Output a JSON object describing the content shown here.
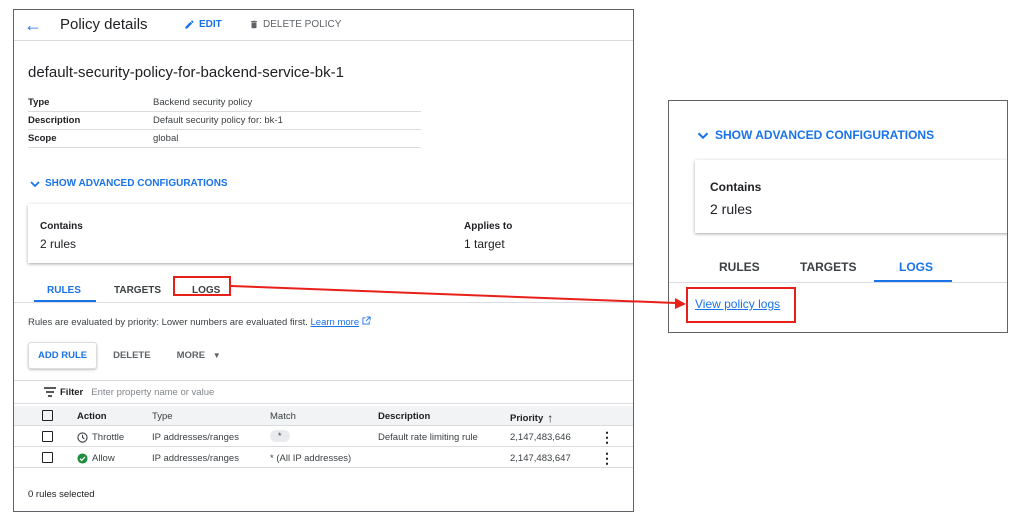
{
  "header": {
    "title": "Policy details",
    "edit_label": "EDIT",
    "delete_label": "DELETE POLICY"
  },
  "policy": {
    "name": "default-security-policy-for-backend-service-bk-1",
    "fields": [
      {
        "key": "Type",
        "value": "Backend security policy"
      },
      {
        "key": "Description",
        "value": "Default security policy for: bk-1"
      },
      {
        "key": "Scope",
        "value": "global"
      }
    ]
  },
  "advanced_label": "SHOW ADVANCED CONFIGURATIONS",
  "summary": {
    "contains_label": "Contains",
    "contains_value": "2 rules",
    "applies_label": "Applies to",
    "applies_value": "1 target"
  },
  "tabs": [
    "RULES",
    "TARGETS",
    "LOGS"
  ],
  "active_tab": "RULES",
  "eval_note": "Rules are evaluated by priority: Lower numbers are evaluated first.",
  "learn_more": "Learn more",
  "actions": {
    "add_rule": "ADD RULE",
    "delete": "DELETE",
    "more": "MORE"
  },
  "filter": {
    "label": "Filter",
    "placeholder": "Enter property name or value"
  },
  "table": {
    "headers": [
      "Action",
      "Type",
      "Match",
      "Description",
      "Priority"
    ],
    "rows": [
      {
        "action": "Throttle",
        "action_icon": "clock-icon",
        "type": "IP addresses/ranges",
        "match": "*",
        "description": "Default rate limiting rule",
        "priority": "2,147,483,646"
      },
      {
        "action": "Allow",
        "action_icon": "check-circle-icon",
        "type": "IP addresses/ranges",
        "match": "* (All IP addresses)",
        "description": "",
        "priority": "2,147,483,647"
      }
    ]
  },
  "selection_info": "0 rules selected",
  "zoom": {
    "advanced_label": "SHOW ADVANCED CONFIGURATIONS",
    "contains_label": "Contains",
    "contains_value": "2 rules",
    "tabs": [
      "RULES",
      "TARGETS",
      "LOGS"
    ],
    "active_tab": "LOGS",
    "link": "View policy logs"
  },
  "colors": {
    "accent": "#1a73e8",
    "callout": "#e8201a",
    "allow_green": "#1e8e3e"
  }
}
